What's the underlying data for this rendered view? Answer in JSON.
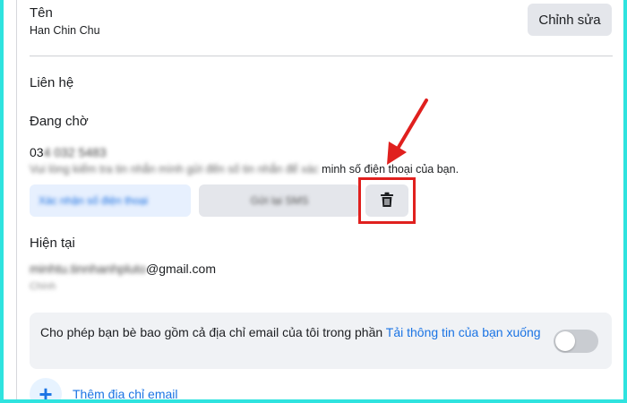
{
  "name_section": {
    "label": "Tên",
    "value": "Han Chin Chu",
    "edit_label": "Chỉnh sửa"
  },
  "contact": {
    "title": "Liên hệ",
    "pending": {
      "title": "Đang chờ",
      "phone_visible": "03",
      "phone_blurred": "4 032 5483",
      "hint_blurred": "Vui lòng kiểm tra tin nhắn mình gửi đến số tin nhắn để xác",
      "hint_visible": " minh số điện thoại của bạn.",
      "confirm_label": "Xác nhận số điện thoại",
      "resend_label": "Gửi lại SMS",
      "delete_icon": "trash-icon"
    },
    "current": {
      "title": "Hiện tại",
      "email_blurred": "minhtu.tinnhanhpluto",
      "email_visible": "@gmail.com",
      "email_sub": "Chính"
    }
  },
  "share_setting": {
    "text": "Cho phép bạn bè bao gồm cả địa chỉ email của tôi trong phần ",
    "link": "Tải thông tin của bạn xuống",
    "toggle_on": false
  },
  "add_email": {
    "icon": "plus-icon",
    "label": "Thêm địa chỉ email"
  },
  "colors": {
    "accent": "#1b74e4",
    "annotation_red": "#e0201e",
    "frame": "#2fe3df"
  }
}
